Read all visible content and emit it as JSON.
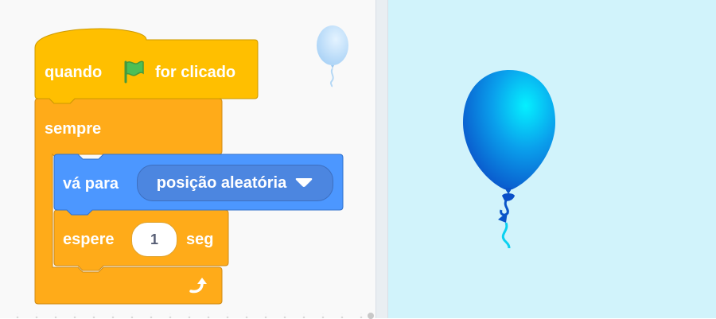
{
  "script": {
    "hat": {
      "prefix": "quando",
      "suffix": "for clicado",
      "icon": "green-flag-icon"
    },
    "forever": {
      "label": "sempre",
      "end_icon": "loop-arrow-icon"
    },
    "goto": {
      "label": "vá para",
      "dropdown_value": "posição aleatória",
      "dropdown_icon": "caret-down-icon"
    },
    "wait": {
      "label": "espere",
      "value": "1",
      "unit": "seg"
    }
  },
  "sprite_thumbnail": {
    "icon": "balloon-icon"
  },
  "stage": {
    "sprite": "balloon-sprite"
  },
  "colors": {
    "events": "#ffbf00",
    "control": "#ffab19",
    "motion": "#4c97ff",
    "stage_background": "#d1f3fb",
    "flag": "#4cbf56"
  }
}
